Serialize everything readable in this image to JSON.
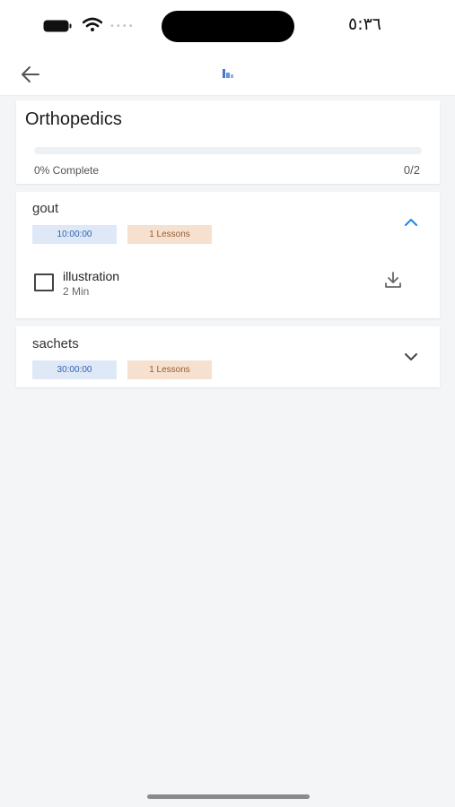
{
  "status": {
    "time": "٥:٣٦",
    "signal_dots": "••••"
  },
  "course": {
    "title": "Orthopedics",
    "progress_label": "0% Complete",
    "progress_count": "0/2",
    "progress_value": 0
  },
  "sections": [
    {
      "title": "gout",
      "duration": "10:00:00",
      "lessons_label": "1 Lessons",
      "expanded": true,
      "lessons": [
        {
          "title": "illustration",
          "duration": "2 Min"
        }
      ]
    },
    {
      "title": "sachets",
      "duration": "30:00:00",
      "lessons_label": "1 Lessons",
      "expanded": false
    }
  ],
  "colors": {
    "accent": "#1e88e5",
    "duration_tag_bg": "#dfe8f6",
    "lessons_tag_bg": "#f6e1d0"
  },
  "icons": {
    "back": "arrow-left-icon",
    "logo": "app-logo-icon",
    "expand": "chevron-up-icon",
    "collapse": "chevron-down-icon",
    "download": "download-icon"
  }
}
